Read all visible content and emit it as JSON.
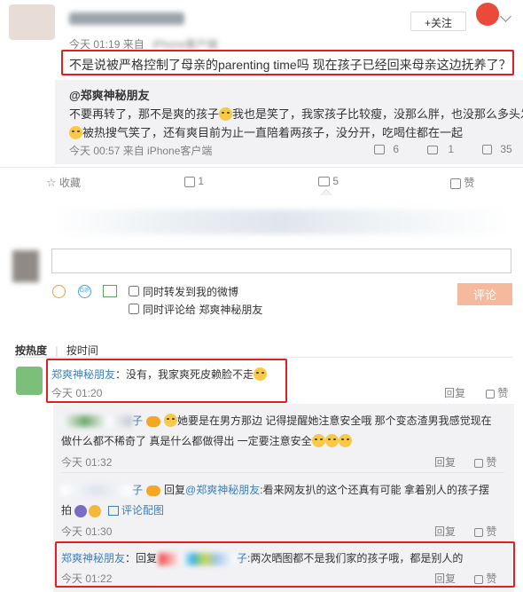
{
  "post": {
    "author_name": "••••••••",
    "time": "今天 01:19 来自",
    "source": "iPhone客户端",
    "text": "不是说被严格控制了母亲的parenting time吗 现在孩子已经回来母亲这边抚养了？",
    "follow_label": "+关注"
  },
  "quote": {
    "author": "@郑爽神秘朋友",
    "text_line1": "不要再转了，那不是爽的孩子",
    "text_line1b": "我也是笑了，我家孩子比较瘦，没那么胖，也没那么多头发",
    "text_line2b": "被热搜气笑了，还有爽目前为止一直陪着两孩子，没分开，吃喝住都在一起",
    "time": "今天 00:57 来自 iPhone客户端",
    "reposts": "6",
    "comments": "1",
    "likes": "35"
  },
  "actions": {
    "favorite": "收藏",
    "repost": "1",
    "comment": "5",
    "like": "赞"
  },
  "composer": {
    "option_repost": "同时转发到我的微博",
    "option_comment": "同时评论给 郑爽神秘朋友",
    "submit": "评论"
  },
  "sort": {
    "hot": "按热度",
    "time": "按时间"
  },
  "comments": [
    {
      "author": "郑爽神秘朋友",
      "text": "：没有，我家爽死皮赖脸不走",
      "time": "今天 01:20",
      "reply": "回复",
      "like": "赞"
    }
  ],
  "replies": [
    {
      "author_suffix": "子",
      "text_line1": "她要是在男方那边 记得提醒她注意安全哦 那个变态渣男我感觉现在",
      "text_line2": "做什么都不稀奇了 真是什么都做得出 一定要注意安全",
      "time": "今天 01:32",
      "reply": "回复",
      "like": "赞"
    },
    {
      "author_suffix": "子",
      "reply_prefix": "回复",
      "reply_to": "@郑爽神秘朋友",
      "text_line1": ":看来网友扒的这个还真有可能 拿着别人的孩子摆",
      "text_line2": "拍",
      "image_label": "评论配图",
      "time": "今天 01:30",
      "reply": "回复",
      "like": "赞"
    },
    {
      "author": "郑爽神秘朋友",
      "reply_prefix": "：回复",
      "text": ":两次晒图都不是我们家的孩子哦，都是别人的",
      "time": "今天 01:22",
      "reply": "回复",
      "like": "赞"
    }
  ],
  "colors": {
    "accent": "#eb7350",
    "highlight": "#e02020",
    "link_blue": "#3b7fb9",
    "submit_bg": "#f7b99d"
  }
}
